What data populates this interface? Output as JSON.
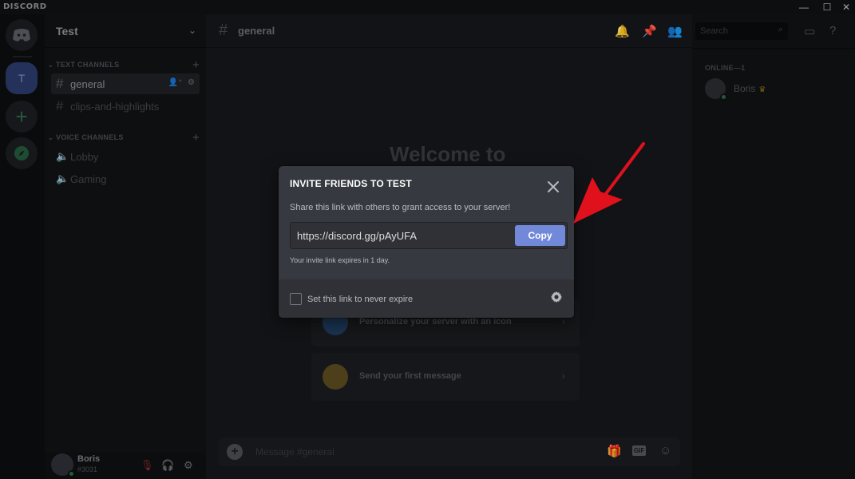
{
  "titlebar": {
    "brand": "DISCORD",
    "minimize": "—",
    "maximize": "☐",
    "close": "✕"
  },
  "rail": {
    "server_initial": "T",
    "add_glyph": "+"
  },
  "server": {
    "name": "Test"
  },
  "text_category": {
    "label": "TEXT CHANNELS"
  },
  "voice_category": {
    "label": "VOICE CHANNELS"
  },
  "text_channels": [
    {
      "name": "general"
    },
    {
      "name": "clips-and-highlights"
    }
  ],
  "voice_channels": [
    {
      "name": "Lobby"
    },
    {
      "name": "Gaming"
    }
  ],
  "user": {
    "name": "Boris",
    "tag": "#3031"
  },
  "chat": {
    "channel": "general",
    "welcome": "Welcome to",
    "cards": [
      {
        "label": "Personalize your server with an icon"
      },
      {
        "label": "Send your first message"
      }
    ],
    "composer_placeholder": "Message #general",
    "gif_label": "GIF"
  },
  "members": {
    "search_placeholder": "Search",
    "online_header": "ONLINE—1",
    "list": [
      {
        "name": "Boris"
      }
    ]
  },
  "modal": {
    "title": "INVITE FRIENDS TO TEST",
    "description": "Share this link with others to grant access to your server!",
    "invite_link": "https://discord.gg/pAyUFA",
    "copy_label": "Copy",
    "expire_note": "Your invite link expires in 1 day.",
    "never_expire_label": "Set this link to never expire"
  },
  "colors": {
    "accent": "#7289da",
    "modal_bg": "#36393f",
    "modal_footer": "#2f3136",
    "arrow": "#e0111d",
    "online": "#43b581"
  },
  "icons": {
    "home": "discord-logo-icon",
    "explore": "compass-icon",
    "mute": "microphone-muted-icon",
    "deafen": "headphones-icon",
    "settings": "gear-icon",
    "bell": "bell-icon",
    "pin": "pin-icon",
    "members": "members-icon",
    "inbox": "inbox-icon",
    "help": "help-icon"
  }
}
